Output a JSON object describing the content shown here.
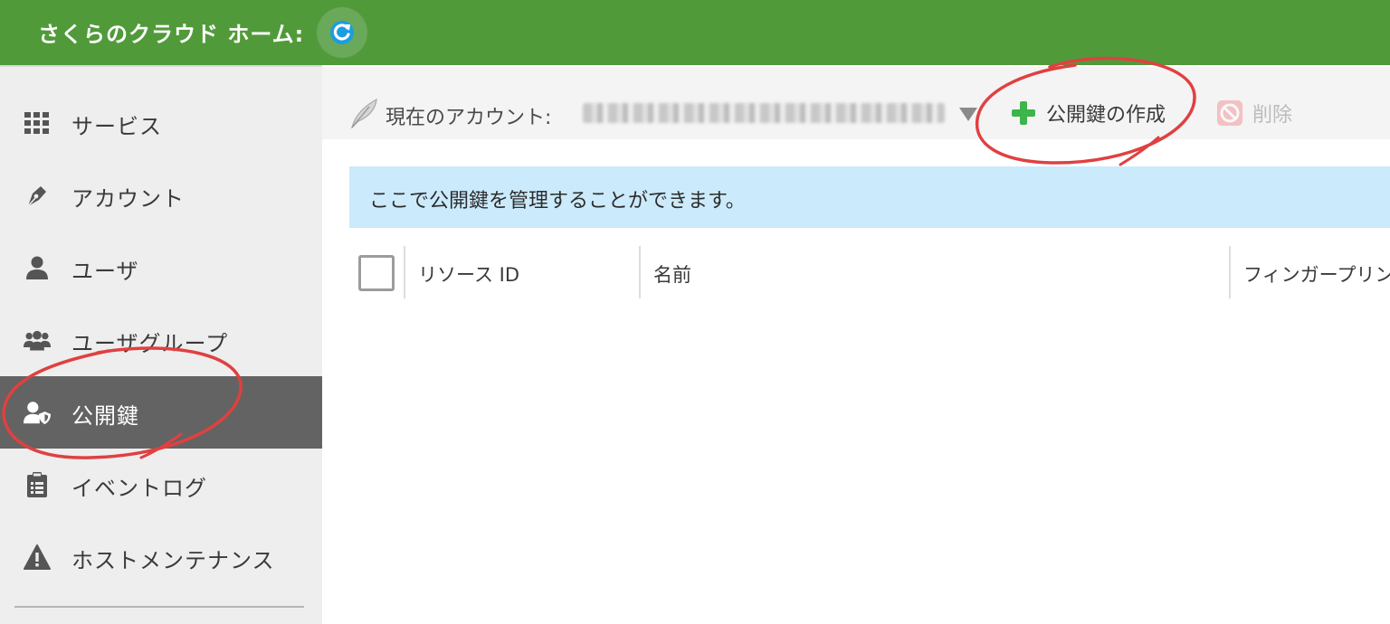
{
  "header": {
    "title": "さくらのクラウド ホーム:",
    "refresh_icon": "refresh-icon"
  },
  "sidebar": {
    "items": [
      {
        "label": "サービス",
        "icon": "grid-icon"
      },
      {
        "label": "アカウント",
        "icon": "pen-nib-icon"
      },
      {
        "label": "ユーザ",
        "icon": "user-icon"
      },
      {
        "label": "ユーザグループ",
        "icon": "users-icon"
      },
      {
        "label": "公開鍵",
        "icon": "user-shield-icon",
        "active": true
      },
      {
        "label": "イベントログ",
        "icon": "clipboard-list-icon"
      },
      {
        "label": "ホストメンテナンス",
        "icon": "warning-icon"
      }
    ]
  },
  "toolbar": {
    "account_label": "現在のアカウント:",
    "account_value": "",
    "create_label": "公開鍵の作成",
    "delete_label": "削除"
  },
  "info": {
    "message": "ここで公開鍵を管理することができます。"
  },
  "table": {
    "columns": [
      "リソース ID",
      "名前",
      "フィンガープリン"
    ]
  },
  "colors": {
    "header_bg": "#519a3a",
    "sidebar_bg": "#eeeeee",
    "active_bg": "#636363",
    "info_bg": "#cbeafb",
    "accent_plus": "#3cb54a",
    "annotation": "#e04040"
  }
}
